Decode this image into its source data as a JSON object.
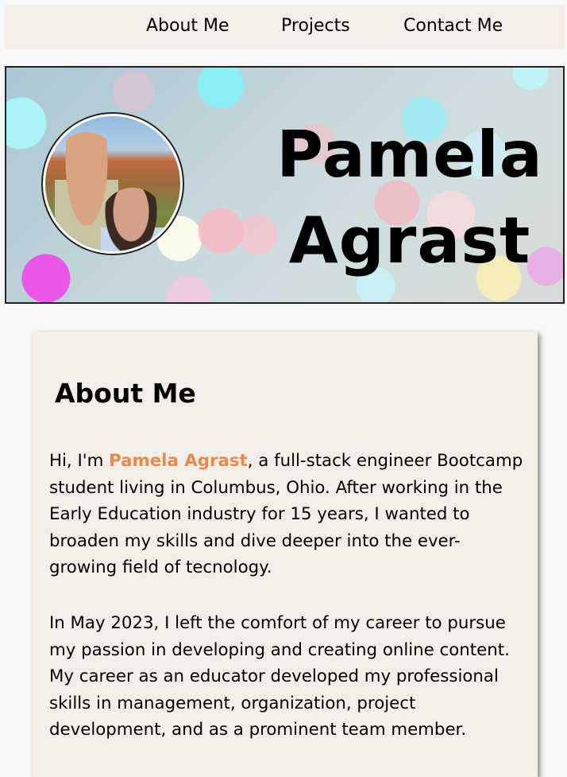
{
  "nav": {
    "items": [
      "About Me",
      "Projects",
      "Contact Me"
    ]
  },
  "hero": {
    "first_name": "Pamela",
    "last_name": "Agrast"
  },
  "about": {
    "heading": "About Me",
    "para1_before": "Hi, I'm ",
    "para1_name": "Pamela Agrast",
    "para1_after": ", a full-stack engineer Bootcamp student living in Columbus, Ohio. After working in the Early Education industry for 15 years, I wanted to broaden my skills and dive deeper into the ever-growing field of tecnology.",
    "para2": "In May 2023, I left the comfort of my career to pursue my passion in developing and creating online content. My career as an educator developed my professional skills in management, organization, project development, and as a prominent team member."
  },
  "colors": {
    "nav_bg": "#f3eee7",
    "card_bg": "#f3eee7",
    "accent": "#e8894f"
  }
}
